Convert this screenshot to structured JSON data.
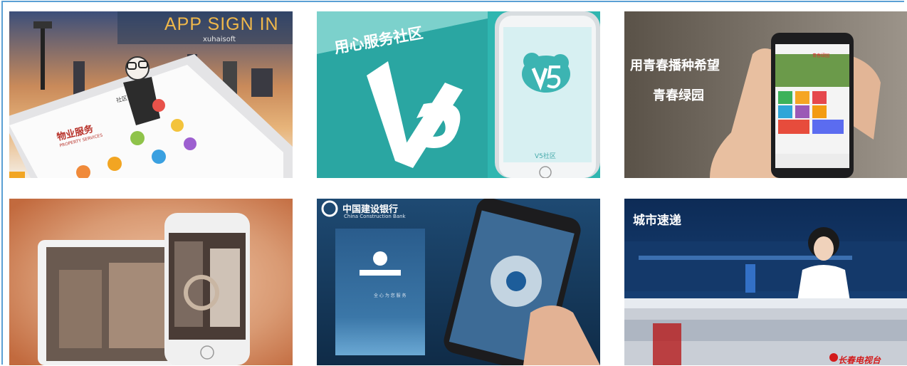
{
  "gallery": {
    "accent_border": "#5a9fd4",
    "items": [
      {
        "title": "APP SIGN IN",
        "subtitle": "xuhaisoft",
        "screen_header": "社区",
        "service_title": "物业服务",
        "service_en": "PROPERTY SERVICES",
        "icon": "phone-app-mockup-icon"
      },
      {
        "slogan": "用心服务社区",
        "phone_caption": "V5社区",
        "icon": "v5-logo-icon"
      },
      {
        "line1": "用青春播种希望",
        "line2": "青春绿园",
        "app_title": "青春绿园",
        "icon": "hand-holding-phone-icon"
      },
      {
        "icon": "tablet-and-phone-mockup-icon"
      },
      {
        "bank_cn": "中国建设银行",
        "bank_en": "China Construction Bank",
        "service_text": "全 心 为 您 服 务",
        "icon": "bank-app-mockup-icon"
      },
      {
        "show_title": "城市速递",
        "station": "长春电视台",
        "icon": "tv-news-anchor-icon"
      }
    ]
  }
}
